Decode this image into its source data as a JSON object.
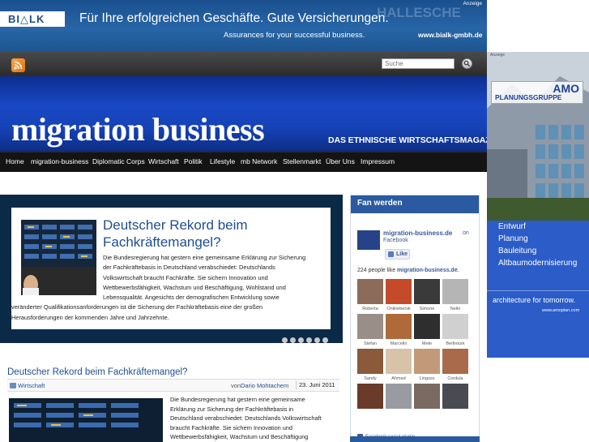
{
  "top_ad": {
    "logo": "BI△LK",
    "headline": "Für Ihre erfolgreichen Geschäfte. Gute Versicherungen.",
    "subline": "Assurances for your successful business.",
    "url": "www.bialk-gmbh.de",
    "anzeige": "Anzeige",
    "background_text": "HALLESCHE"
  },
  "toolbar": {
    "rss_icon": "rss-icon",
    "search_placeholder": "Suche",
    "search_icon": "search-icon"
  },
  "masthead": {
    "title": "migration business",
    "tagline": "DAS ETHNISCHE WIRTSCHAFTSMAGAZIN",
    "color": "#1a48c4"
  },
  "nav": {
    "items": [
      "Home",
      "migration-business",
      "Diplomatic Corps",
      "Wirtschaft",
      "Politik",
      "Lifestyle",
      "mb Network",
      "Stellenmarkt",
      "Über Uns",
      "Impressum"
    ]
  },
  "featured": {
    "title": "Deutscher Rekord beim Fachkräftemangel?",
    "text_lines": [
      "Die Bundesregierung hat gestern eine gemeinsame Erklärung zur Sicherung",
      "der Fachkräftebasis in Deutschland verabschiedet: Deutschlands",
      "Volkswirtschaft braucht Fachkräfte. Sie sichern Innovation und",
      "Wettbewerbsfähigkeit, Wachstum und Beschäftigung, Wohlstand und",
      "Lebensqualität. Angesichts der demografischen Entwicklung sowie",
      "veränderter Qualifikationsanforderungen ist die Sicherung der Fachkräftebasis eine der großen",
      "Herausforderungen der kommenden Jahre und Jahrzehnte."
    ],
    "slide_count": 6
  },
  "post": {
    "title": "Deutscher Rekord beim Fachkräftemangel?",
    "category": "Wirtschaft",
    "author_prefix": "von",
    "author": "Dario Mohtachem",
    "date": "23. Juni 2011",
    "text_lines": [
      "Die Bundesregierung hat gestern eine gemeinsame",
      "Erklärung zur Sicherung der Fachkräftebasis in",
      "Deutschland verabschiedet: Deutschlands Volkswirtschaft",
      "braucht Fachkräfte. Sie sichern Innovation und",
      "Wettbewerbsfähigkeit, Wachstum und Beschäftigung"
    ]
  },
  "fan_box": {
    "header": "Fan werden",
    "page_name": "migration-business.de",
    "on": "on",
    "site": "Facebook",
    "like_label": "Like",
    "count_prefix": "224 people like",
    "count_page": "migration-business.de",
    "count_suffix": ".",
    "fans": [
      {
        "name": "Roberta",
        "color": "#8c6b5a"
      },
      {
        "name": "Onlinebersk",
        "color": "#c44a2a"
      },
      {
        "name": "Simone",
        "color": "#3a3a3a"
      },
      {
        "name": "Nelin",
        "color": "#b5b5b5"
      },
      {
        "name": "Stefan",
        "color": "#9a8f88"
      },
      {
        "name": "Marcello",
        "color": "#b06a3a"
      },
      {
        "name": "Mete",
        "color": "#2e2e2e"
      },
      {
        "name": "Berlinturk",
        "color": "#d0d0d0"
      },
      {
        "name": "Sandy",
        "color": "#8a5a3a"
      },
      {
        "name": "Ahmed",
        "color": "#d8c2a8"
      },
      {
        "name": "Lingsss",
        "color": "#c29a7a"
      },
      {
        "name": "Cordula",
        "color": "#a86a4a"
      },
      {
        "name": "",
        "color": "#6a3a2a"
      },
      {
        "name": "",
        "color": "#9a9aa2"
      },
      {
        "name": "",
        "color": "#7a6a60"
      },
      {
        "name": "",
        "color": "#4a4a52"
      }
    ],
    "footer": "Facebook social plugin"
  },
  "side_ad": {
    "anzeige": "Anzeige",
    "brand": "AMO",
    "brand_sub": "PLANUNGSGRUPPE",
    "services": [
      "Entwurf",
      "Planung",
      "Bauleitung",
      "Altbaumodernisierung"
    ],
    "slogan": "architecture for tomorrow.",
    "url": "www.amoplan.com"
  }
}
